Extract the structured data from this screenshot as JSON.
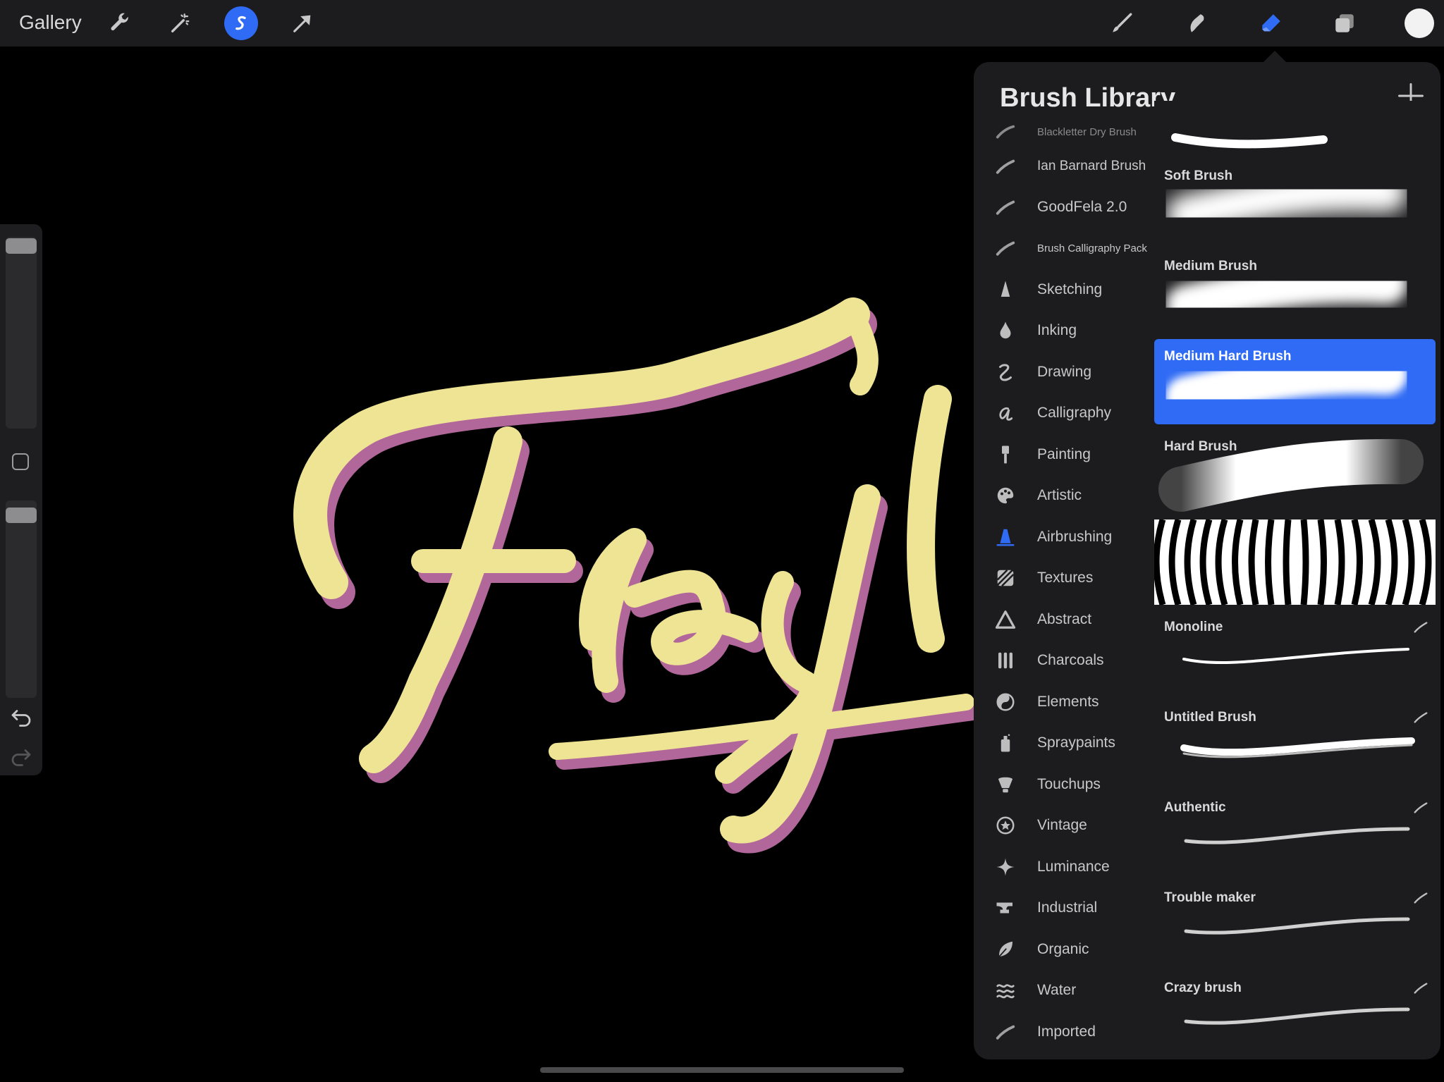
{
  "topbar": {
    "gallery_label": "Gallery",
    "tools": [
      {
        "name": "wrench-icon"
      },
      {
        "name": "magic-wand-icon"
      },
      {
        "name": "selection-icon"
      },
      {
        "name": "transform-arrow-icon"
      },
      {
        "name": "brush-tool-icon"
      },
      {
        "name": "smudge-tool-icon"
      },
      {
        "name": "eraser-tool-icon"
      },
      {
        "name": "layers-icon"
      },
      {
        "name": "color-picker-icon"
      }
    ],
    "accent": "#2f6bf4"
  },
  "brush_library": {
    "title": "Brush Library",
    "categories": [
      {
        "label": "Blackletter Dry Brush",
        "icon": "brush-stroke-icon"
      },
      {
        "label": "Ian Barnard Brush",
        "icon": "brush-stroke-icon"
      },
      {
        "label": "GoodFela 2.0",
        "icon": "brush-stroke-icon"
      },
      {
        "label": "Brush Calligraphy Pack",
        "icon": "brush-stroke-icon"
      },
      {
        "label": "Sketching",
        "icon": "pencil-tip-icon"
      },
      {
        "label": "Inking",
        "icon": "ink-drop-icon"
      },
      {
        "label": "Drawing",
        "icon": "squiggle-icon"
      },
      {
        "label": "Calligraphy",
        "icon": "script-a-icon"
      },
      {
        "label": "Painting",
        "icon": "paint-brush-icon"
      },
      {
        "label": "Artistic",
        "icon": "palette-icon"
      },
      {
        "label": "Airbrushing",
        "icon": "airbrush-icon"
      },
      {
        "label": "Textures",
        "icon": "hatch-icon"
      },
      {
        "label": "Abstract",
        "icon": "triangle-icon"
      },
      {
        "label": "Charcoals",
        "icon": "charcoal-bars-icon"
      },
      {
        "label": "Elements",
        "icon": "yin-yang-icon"
      },
      {
        "label": "Spraypaints",
        "icon": "spray-can-icon"
      },
      {
        "label": "Touchups",
        "icon": "touchup-icon"
      },
      {
        "label": "Vintage",
        "icon": "star-badge-icon"
      },
      {
        "label": "Luminance",
        "icon": "sparkle-icon"
      },
      {
        "label": "Industrial",
        "icon": "anvil-icon"
      },
      {
        "label": "Organic",
        "icon": "leaf-icon"
      },
      {
        "label": "Water",
        "icon": "waves-icon"
      },
      {
        "label": "Imported",
        "icon": "brush-stroke-icon"
      }
    ],
    "brushes": [
      {
        "name": "Soft Brush"
      },
      {
        "name": "Medium Brush"
      },
      {
        "name": "Medium Hard Brush"
      },
      {
        "name": "Hard Brush"
      },
      {
        "name": ""
      },
      {
        "name": "Monoline"
      },
      {
        "name": "Untitled Brush"
      },
      {
        "name": "Authentic"
      },
      {
        "name": "Trouble maker"
      },
      {
        "name": "Crazy brush"
      }
    ],
    "selected_brush": "Medium Hard Brush",
    "selected_category": "Airbrushing"
  }
}
